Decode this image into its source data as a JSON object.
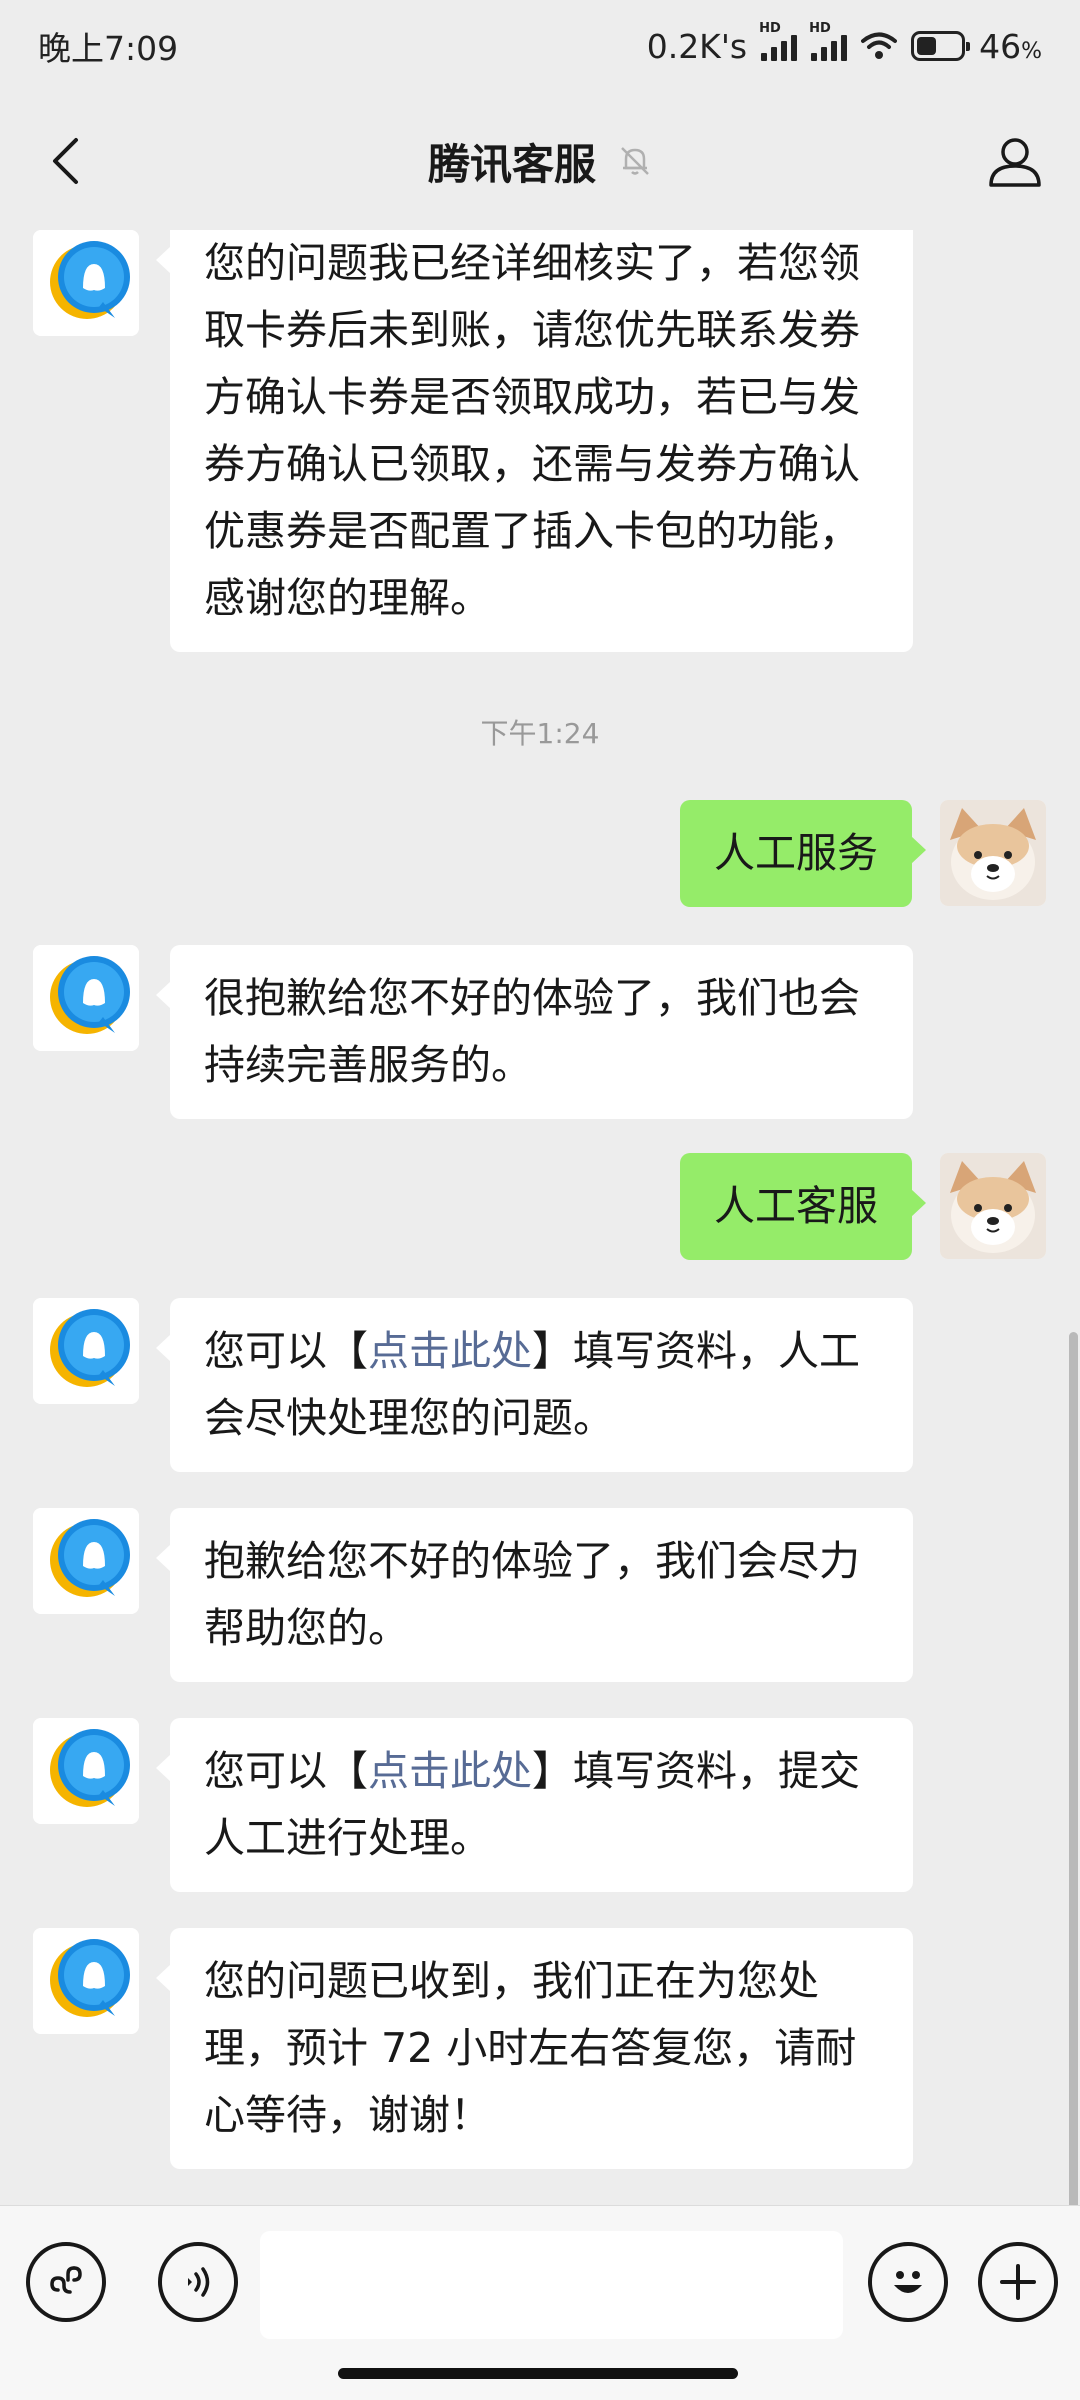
{
  "status_bar": {
    "time": "晚上7:09",
    "network_speed": "0.2K's",
    "signal_label_1": "HD",
    "signal_label_2": "HD",
    "battery_percent": "46",
    "battery_level": 0.46,
    "icons": [
      "signal-icon",
      "signal-icon",
      "wifi-icon",
      "battery-icon"
    ]
  },
  "header": {
    "title": "腾讯客服",
    "muted_icon": "bell-off-icon",
    "back_icon": "chevron-left-icon",
    "profile_icon": "person-icon"
  },
  "messages": [
    {
      "side": "left",
      "text": "您的问题我已经详细核实了，若您领取卡券后未到账，请您优先联系发券方确认卡券是否领取成功，若已与发券方确认已领取，还需与发券方确认优惠券是否配置了插入卡包的功能，感谢您的理解。"
    },
    {
      "timestamp": "下午1:24"
    },
    {
      "side": "right",
      "text": "人工服务"
    },
    {
      "side": "left",
      "text": "很抱歉给您不好的体验了，我们也会持续完善服务的。"
    },
    {
      "side": "right",
      "text": "人工客服"
    },
    {
      "side": "left",
      "text_before": "您可以【",
      "link": "点击此处",
      "text_after": "】填写资料，人工会尽快处理您的问题。"
    },
    {
      "side": "left",
      "text": "抱歉给您不好的体验了，我们会尽力帮助您的。"
    },
    {
      "side": "left",
      "text_before": "您可以【",
      "link": "点击此处",
      "text_after": "】填写资料，提交人工进行处理。"
    },
    {
      "side": "left",
      "text": "您的问题已收到，我们正在为您处理，预计 72 小时左右答复您，请耐心等待，谢谢！"
    }
  ],
  "input_bar": {
    "miniprogram_icon": "link-icon",
    "voice_icon": "voice-icon",
    "emoji_icon": "smiley-icon",
    "more_icon": "plus-icon",
    "input_value": ""
  },
  "colors": {
    "background": "#ededed",
    "incoming_bubble": "#ffffff",
    "outgoing_bubble": "#95ec69",
    "link": "#576b95"
  }
}
